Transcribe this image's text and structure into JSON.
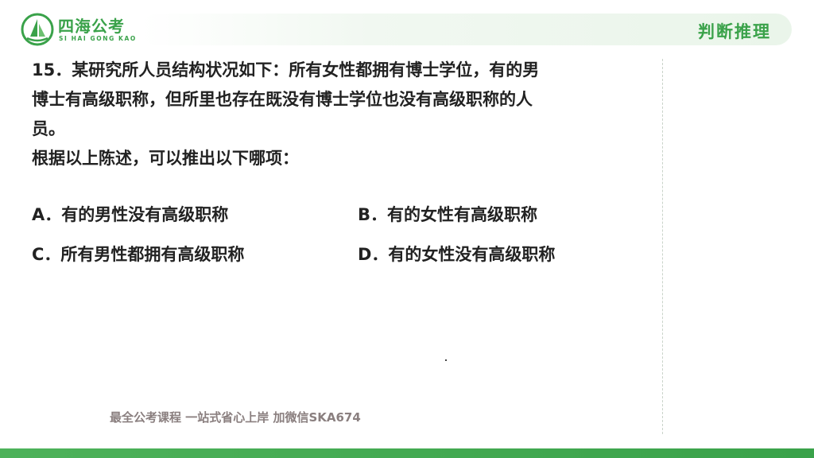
{
  "brand": {
    "name": "四海公考",
    "subtitle": "SI HAI GONG KAO"
  },
  "section_tag": "判断推理",
  "question": {
    "lines": [
      "15．某研究所人员结构状况如下：所有女性都拥有博士学位，有的男",
      "博士有高级职称，但所里也存在既没有博士学位也没有高级职称的人",
      "员。",
      "根据以上陈述，可以推出以下哪项："
    ]
  },
  "options": [
    {
      "text": "A．有的男性没有高级职称"
    },
    {
      "text": "B．有的女性有高级职称"
    },
    {
      "text": "C．所有男性都拥有高级职称"
    },
    {
      "text": "D．有的女性没有高级职称"
    }
  ],
  "watermark": "最全公考课程 一站式省心上岸 加微信SKA674",
  "colors": {
    "brand_green": "#3aa24a",
    "text": "#222222",
    "watermark": "#8a7f7f"
  }
}
